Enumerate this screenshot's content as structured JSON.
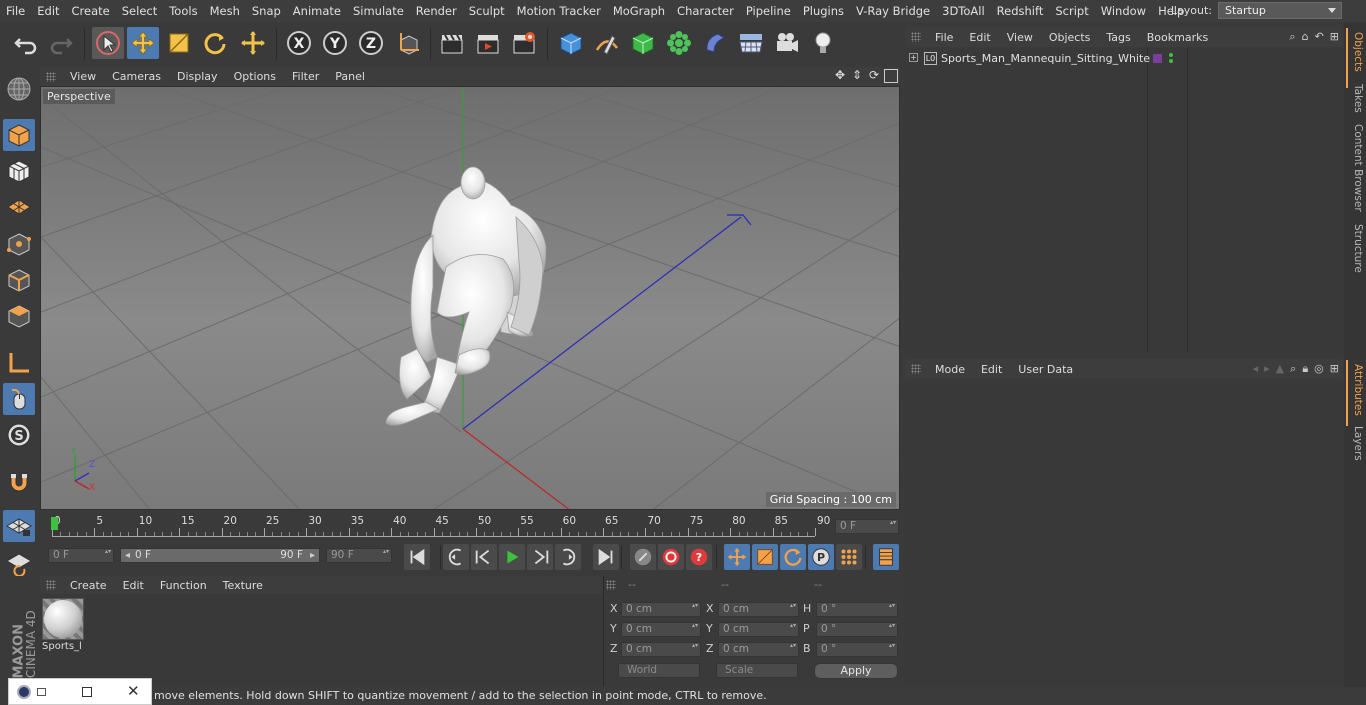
{
  "menubar": {
    "items": [
      "File",
      "Edit",
      "Create",
      "Select",
      "Tools",
      "Mesh",
      "Snap",
      "Animate",
      "Simulate",
      "Render",
      "Sculpt",
      "Motion Tracker",
      "MoGraph",
      "Character",
      "Pipeline",
      "Plugins",
      "V-Ray Bridge",
      "3DToAll",
      "Redshift",
      "Script",
      "Window",
      "Help"
    ],
    "layout_label": "Layout:",
    "layout_value": "Startup"
  },
  "viewport": {
    "menu": [
      "View",
      "Cameras",
      "Display",
      "Options",
      "Filter",
      "Panel"
    ],
    "label": "Perspective",
    "grid_spacing": "Grid Spacing : 100 cm",
    "axis_x": "X",
    "axis_y": "Y",
    "axis_z": "Z"
  },
  "timeline": {
    "ticks": [
      "0",
      "5",
      "10",
      "15",
      "20",
      "25",
      "30",
      "35",
      "40",
      "45",
      "50",
      "55",
      "60",
      "65",
      "70",
      "75",
      "80",
      "85",
      "90"
    ],
    "current_frame": "0 F",
    "start_field": "0 F",
    "range_start": "0 F",
    "range_end": "90 F",
    "end_field": "90 F"
  },
  "objects_panel": {
    "menu": [
      "File",
      "Edit",
      "View",
      "Objects",
      "Tags",
      "Bookmarks"
    ],
    "object_name": "Sports_Man_Mannequin_Sitting_White",
    "layer_badge": "L0"
  },
  "attributes_panel": {
    "menu": [
      "Mode",
      "Edit",
      "User Data"
    ]
  },
  "right_tabs": {
    "top": [
      "Objects",
      "Takes",
      "Content Browser",
      "Structure"
    ],
    "bottom": [
      "Attributes",
      "Layers"
    ]
  },
  "material_panel": {
    "menu": [
      "Create",
      "Edit",
      "Function",
      "Texture"
    ],
    "material_name": "Sports_l"
  },
  "coordinates": {
    "headers": [
      "--",
      "--",
      "--"
    ],
    "pos_labels": [
      "X",
      "Y",
      "Z"
    ],
    "pos_values": [
      "0 cm",
      "0 cm",
      "0 cm"
    ],
    "size_labels": [
      "X",
      "Y",
      "Z"
    ],
    "size_values": [
      "0 cm",
      "0 cm",
      "0 cm"
    ],
    "rot_labels": [
      "H",
      "P",
      "B"
    ],
    "rot_values": [
      "0 °",
      "0 °",
      "0 °"
    ],
    "mode_world": "World",
    "mode_scale": "Scale",
    "apply": "Apply"
  },
  "brand": {
    "maxon": "MAXON",
    "cinema": "CINEMA 4D"
  },
  "status": {
    "text": "move elements. Hold down SHIFT to quantize movement / add to the selection in point mode, CTRL to remove."
  },
  "colors": {
    "accent_blue": "#5c8fc4",
    "active_btn": "#4d7ab0",
    "axis_x": "#c03030",
    "axis_y": "#30a030",
    "axis_z": "#3030c0",
    "play_green": "#3ec13e"
  }
}
